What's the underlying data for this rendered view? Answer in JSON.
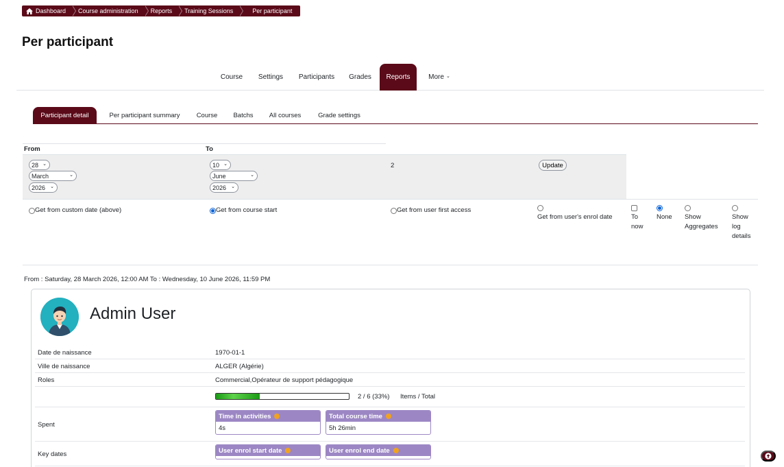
{
  "breadcrumb": {
    "items": [
      "Dashboard",
      "Course administration",
      "Reports",
      "Training Sessions",
      "Per participant"
    ]
  },
  "page_title": "Per participant",
  "primary_nav": {
    "items": [
      "Course",
      "Settings",
      "Participants",
      "Grades",
      "Reports",
      "More"
    ],
    "active": "Reports"
  },
  "secondary_nav": {
    "items": [
      "Participant detail",
      "Per participant summary",
      "Course",
      "Batchs",
      "All courses",
      "Grade settings"
    ],
    "active": "Participant detail"
  },
  "form": {
    "from_label": "From",
    "to_label": "To",
    "from_day": "28",
    "from_month": "March",
    "from_year": "2026",
    "to_day": "10",
    "to_month": "June",
    "to_year": "2026",
    "value": "2",
    "update_label": "Update",
    "options": {
      "custom_date": "Get from custom date (above)",
      "course_start": "Get from course start",
      "first_access": "Get from user first access",
      "enrol_date": "Get from user's enrol date",
      "to_now_1": "To",
      "to_now_2": "now",
      "none": "None",
      "aggregates_1": "Show",
      "aggregates_2": "Aggregates",
      "log_1": "Show",
      "log_2": "log",
      "log_3": "details"
    },
    "selected_option": "Get from course start",
    "selected_extra": "None"
  },
  "range_text": "From : Saturday, 28 March 2026, 12:00 AM To : Wednesday, 10 June 2026, 11:59 PM",
  "user": {
    "name": "Admin User",
    "fields": [
      {
        "label": "Date de naissance",
        "value": "1970-01-1"
      },
      {
        "label": "Ville de naissance",
        "value": "ALGER (Algérie)"
      },
      {
        "label": "Roles",
        "value": "Commercial,Opérateur de support pédagogique"
      }
    ],
    "progress": {
      "text": "2 / 6 (33%)",
      "suffix": "Items / Total",
      "fraction": 0.33
    },
    "spent_label": "Spent",
    "time_in_activities": {
      "title": "Time in activities",
      "value": "4s"
    },
    "total_course_time": {
      "title": "Total course time",
      "value": "5h 26min"
    },
    "key_dates_label": "Key dates",
    "enrol_start": {
      "title": "User enrol start date",
      "value": ""
    },
    "enrol_end": {
      "title": "User enrol end date",
      "value": ""
    }
  },
  "colors": {
    "brand": "#5b0a19",
    "stat_header": "#9c87c4",
    "radio_checked": "#0b63d6",
    "progress": "#3cbf2e"
  },
  "icons": [
    "home-icon",
    "chevron-down-icon",
    "info-icon",
    "arrow-up-icon"
  ]
}
